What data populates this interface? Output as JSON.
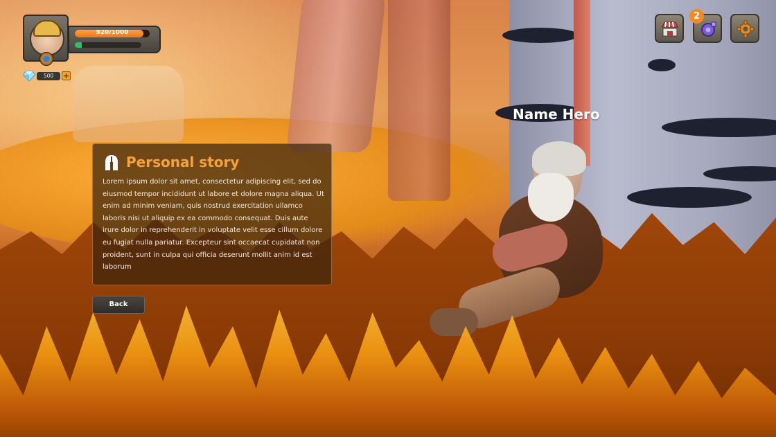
{
  "player": {
    "hp_text": "920/1000",
    "hp_fraction": 0.92,
    "xp_fraction": 0.1,
    "gems": "500",
    "add_gems_label": "+"
  },
  "top_bar": {
    "shop_icon": "shop-stall-icon",
    "gear_badge_count": "2",
    "settings_icon": "gear-icon"
  },
  "hero": {
    "name": "Name Hero"
  },
  "story": {
    "title": "Personal story",
    "text": "Lorem ipsum dolor sit amet, consectetur adipiscing elit, sed do eiusmod tempor incididunt ut labore et dolore magna aliqua. Ut enim ad minim veniam, quis nostrud exercitation ullamco laboris nisi ut aliquip ex ea commodo consequat. Duis aute irure dolor in reprehenderit in voluptate velit esse cillum dolore eu fugiat nulla pariatur. Excepteur sint occaecat cupidatat non proident, sunt in culpa qui officia deserunt mollit anim id est laborum"
  },
  "buttons": {
    "back_label": "Back"
  },
  "colors": {
    "accent": "#f7a33a",
    "hp": "#f07714",
    "xp": "#2cc06a",
    "badge": "#f08a24"
  }
}
